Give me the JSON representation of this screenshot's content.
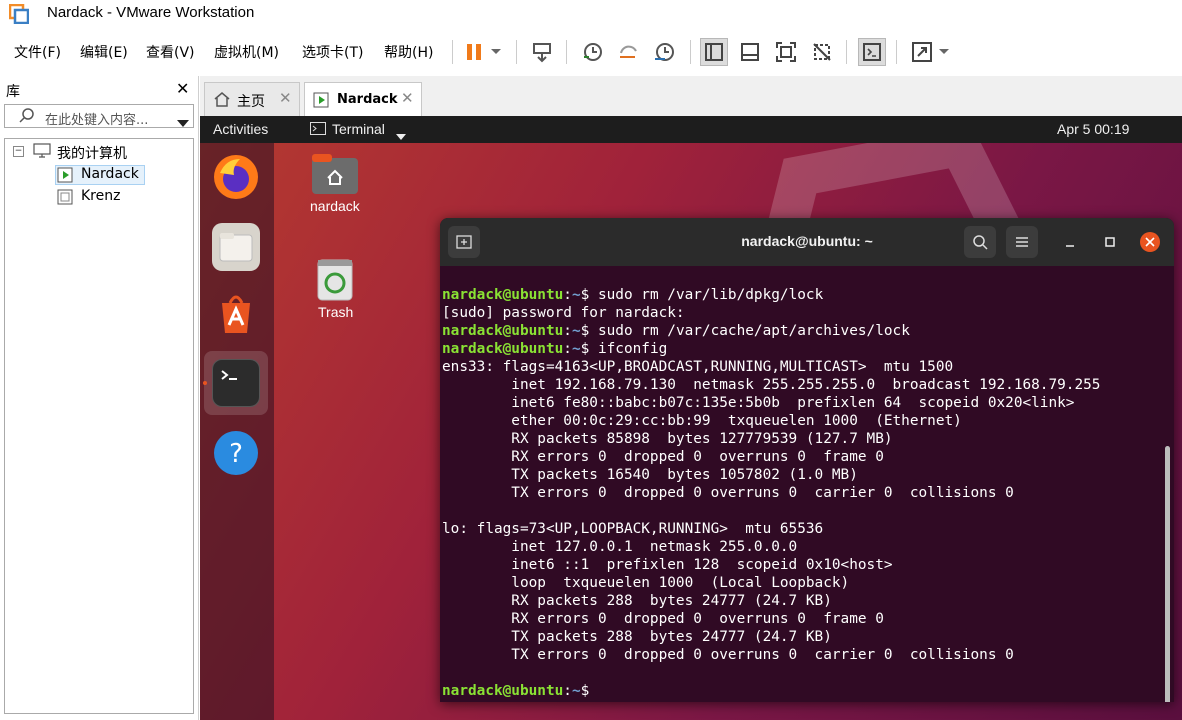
{
  "window": {
    "title": "Nardack - VMware Workstation"
  },
  "menu": [
    "文件(F)",
    "编辑(E)",
    "查看(V)",
    "虚拟机(M)",
    "选项卡(T)",
    "帮助(H)"
  ],
  "library": {
    "title": "库",
    "search_placeholder": "在此处键入内容...",
    "root": "我的计算机",
    "vms": [
      "Nardack",
      "Krenz"
    ]
  },
  "tabs": [
    {
      "label": "主页",
      "icon": "home-icon"
    },
    {
      "label": "Nardack",
      "icon": "vm-running-icon"
    }
  ],
  "guest": {
    "activities": "Activities",
    "app_menu": "Terminal",
    "clock": "Apr 5  00:19",
    "desktop_icons": [
      {
        "label": "nardack",
        "icon": "home-folder-icon"
      },
      {
        "label": "Trash",
        "icon": "trash-icon"
      }
    ],
    "dock": [
      "firefox-icon",
      "files-icon",
      "software-icon",
      "terminal-icon",
      "help-icon"
    ]
  },
  "terminal": {
    "title": "nardack@ubuntu: ~",
    "prompt_user": "nardack@ubuntu",
    "prompt_path": "~",
    "lines": [
      {
        "type": "cmd",
        "text": "sudo rm /var/lib/dpkg/lock"
      },
      {
        "type": "out",
        "text": "[sudo] password for nardack:"
      },
      {
        "type": "cmd",
        "text": "sudo rm /var/cache/apt/archives/lock"
      },
      {
        "type": "cmd",
        "text": "ifconfig"
      },
      {
        "type": "out",
        "text": "ens33: flags=4163<UP,BROADCAST,RUNNING,MULTICAST>  mtu 1500"
      },
      {
        "type": "out",
        "text": "        inet 192.168.79.130  netmask 255.255.255.0  broadcast 192.168.79.255"
      },
      {
        "type": "out",
        "text": "        inet6 fe80::babc:b07c:135e:5b0b  prefixlen 64  scopeid 0x20<link>"
      },
      {
        "type": "out",
        "text": "        ether 00:0c:29:cc:bb:99  txqueuelen 1000  (Ethernet)"
      },
      {
        "type": "out",
        "text": "        RX packets 85898  bytes 127779539 (127.7 MB)"
      },
      {
        "type": "out",
        "text": "        RX errors 0  dropped 0  overruns 0  frame 0"
      },
      {
        "type": "out",
        "text": "        TX packets 16540  bytes 1057802 (1.0 MB)"
      },
      {
        "type": "out",
        "text": "        TX errors 0  dropped 0 overruns 0  carrier 0  collisions 0"
      },
      {
        "type": "out",
        "text": ""
      },
      {
        "type": "out",
        "text": "lo: flags=73<UP,LOOPBACK,RUNNING>  mtu 65536"
      },
      {
        "type": "out",
        "text": "        inet 127.0.0.1  netmask 255.0.0.0"
      },
      {
        "type": "out",
        "text": "        inet6 ::1  prefixlen 128  scopeid 0x10<host>"
      },
      {
        "type": "out",
        "text": "        loop  txqueuelen 1000  (Local Loopback)"
      },
      {
        "type": "out",
        "text": "        RX packets 288  bytes 24777 (24.7 KB)"
      },
      {
        "type": "out",
        "text": "        RX errors 0  dropped 0  overruns 0  frame 0"
      },
      {
        "type": "out",
        "text": "        TX packets 288  bytes 24777 (24.7 KB)"
      },
      {
        "type": "out",
        "text": "        TX errors 0  dropped 0 overruns 0  carrier 0  collisions 0"
      },
      {
        "type": "out",
        "text": ""
      },
      {
        "type": "cmd",
        "text": ""
      }
    ]
  }
}
